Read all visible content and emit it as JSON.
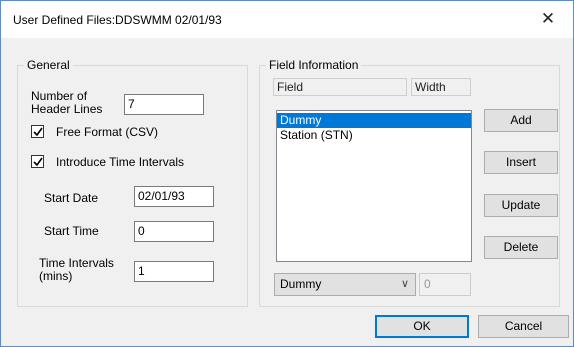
{
  "window": {
    "title": "User Defined Files:DDSWMM 02/01/93"
  },
  "general": {
    "legend": "General",
    "header_lines_label_1": "Number of",
    "header_lines_label_2": "Header Lines",
    "header_lines_value": "7",
    "free_format_label": "Free Format (CSV)",
    "free_format_checked": true,
    "introduce_intervals_label": "Introduce Time Intervals",
    "introduce_intervals_checked": true,
    "start_date_label": "Start Date",
    "start_date_value": "02/01/93",
    "start_time_label": "Start Time",
    "start_time_value": "0",
    "time_intervals_label_1": "Time Intervals",
    "time_intervals_label_2": "(mins)",
    "time_intervals_value": "1"
  },
  "field_info": {
    "legend": "Field Information",
    "field_header": "Field",
    "width_header": "Width",
    "fields": [
      "Dummy",
      "Station (STN)"
    ],
    "selected_field": "Dummy",
    "type_combo_value": "Dummy",
    "width_value": "0",
    "add_label": "Add",
    "insert_label": "Insert",
    "update_label": "Update",
    "delete_label": "Delete"
  },
  "footer": {
    "ok_label": "OK",
    "cancel_label": "Cancel"
  }
}
